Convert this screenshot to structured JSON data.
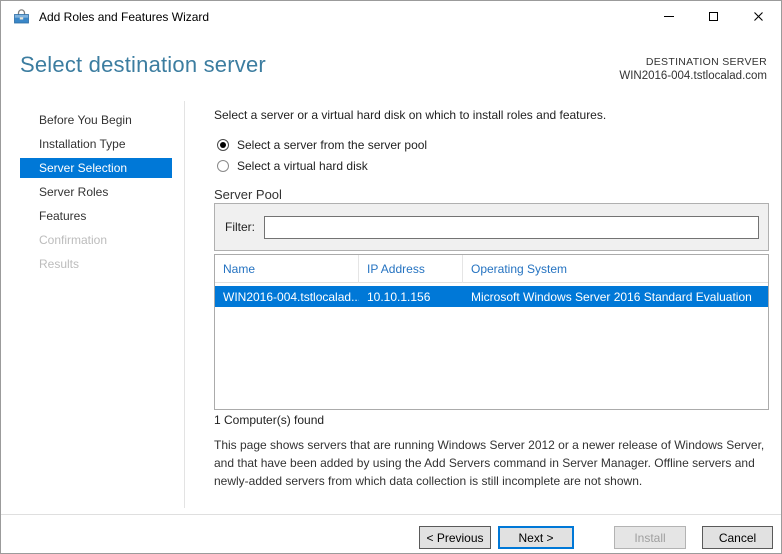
{
  "window": {
    "title": "Add Roles and Features Wizard",
    "controls": [
      "minimize",
      "maximize",
      "close"
    ]
  },
  "header": {
    "title": "Select destination server",
    "destination_label": "DESTINATION SERVER",
    "destination_server": "WIN2016-004.tstlocalad.com"
  },
  "sidebar": {
    "items": [
      {
        "label": "Before You Begin",
        "state": "normal"
      },
      {
        "label": "Installation Type",
        "state": "normal"
      },
      {
        "label": "Server Selection",
        "state": "selected"
      },
      {
        "label": "Server Roles",
        "state": "normal"
      },
      {
        "label": "Features",
        "state": "normal"
      },
      {
        "label": "Confirmation",
        "state": "disabled"
      },
      {
        "label": "Results",
        "state": "disabled"
      }
    ]
  },
  "content": {
    "intro": "Select a server or a virtual hard disk on which to install roles and features.",
    "radios": [
      {
        "label": "Select a server from the server pool",
        "selected": true
      },
      {
        "label": "Select a virtual hard disk",
        "selected": false
      }
    ],
    "server_pool": {
      "section_title": "Server Pool",
      "filter_label": "Filter:",
      "filter_value": "",
      "table": {
        "columns": [
          "Name",
          "IP Address",
          "Operating System"
        ],
        "rows": [
          {
            "name": "WIN2016-004.tstlocalad....",
            "ip": "10.10.1.156",
            "os": "Microsoft Windows Server 2016 Standard Evaluation",
            "selected": true
          }
        ]
      },
      "count_text": "1 Computer(s) found"
    },
    "note": "This page shows servers that are running Windows Server 2012 or a newer release of Windows Server, and that have been added by using the Add Servers command in Server Manager. Offline servers and newly-added servers from which data collection is still incomplete are not shown."
  },
  "footer": {
    "buttons": [
      {
        "label": "< Previous",
        "state": "enabled"
      },
      {
        "label": "Next >",
        "state": "default"
      },
      {
        "label": "Install",
        "state": "disabled"
      },
      {
        "label": "Cancel",
        "state": "enabled"
      }
    ]
  },
  "colors": {
    "accent": "#0078d7",
    "heading_text": "#3c7da0",
    "table_header_text": "#2573c1",
    "selection_text": "#ffffff"
  }
}
